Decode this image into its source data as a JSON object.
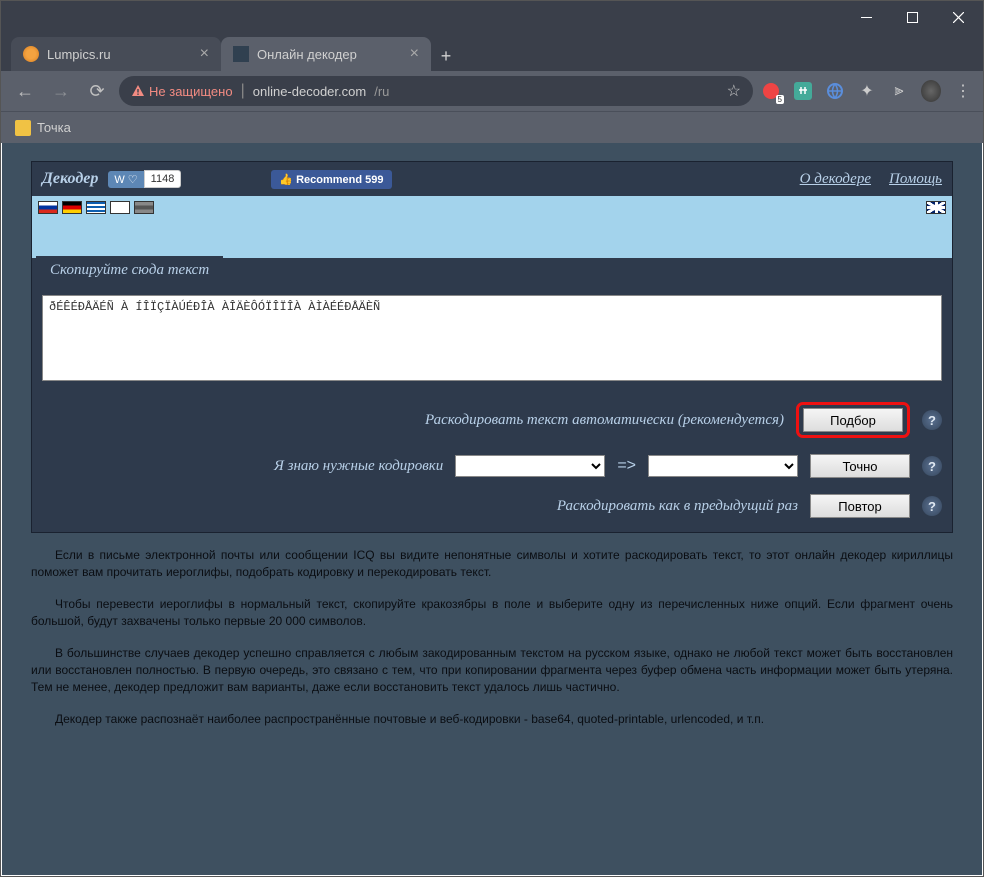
{
  "window": {
    "tabs": [
      {
        "title": "Lumpics.ru"
      },
      {
        "title": "Онлайн декодер"
      }
    ]
  },
  "address": {
    "secure_label": "Не защищено",
    "host": "online-decoder.com",
    "path": "/ru"
  },
  "bookmarks": {
    "item0": "Точка"
  },
  "ext": {
    "badge": "5"
  },
  "decoder": {
    "brand": "Декодер",
    "vk_count": "1148",
    "fb_label": "Recommend 599",
    "link_about": "О декодере",
    "link_help": "Помощь",
    "section_label": "Скопируйте сюда текст",
    "textarea_value": "ðÉÊÉÐÅÄÉÑ À ÍÎÏÇÏÀÚÉÐÎÀ ÀÎÄÈÔÓÏÎÏÎÀ ÀÌÀÉÉÐÅÄÈÑ",
    "row1_label": "Раскодировать текст автоматически (рекомендуется)",
    "row2_label": "Я знаю нужные кодировки",
    "row3_label": "Раскодировать как в предыдущий раз",
    "btn_podbor": "Подбор",
    "btn_tochno": "Точно",
    "btn_povtor": "Повтор"
  },
  "paragraphs": {
    "p1": "Если в письме электронной почты или сообщении ICQ вы видите непонятные символы и хотите раскодировать текст, то этот онлайн декодер кириллицы поможет вам прочитать иероглифы, подобрать кодировку и перекодировать текст.",
    "p2": "Чтобы перевести иероглифы в нормальный текст, скопируйте кракозябры в поле и выберите одну из перечисленных ниже опций. Если фрагмент очень большой, будут захвачены только первые 20 000 символов.",
    "p3": "В большинстве случаев декодер успешно справляется с любым закодированным текстом на русском языке, однако не любой текст может быть восстановлен или восстановлен полностью. В первую очередь, это связано с тем, что при копировании фрагмента через буфер обмена часть информации может быть утеряна. Тем не менее, декодер предложит вам варианты, даже если восстановить текст удалось лишь частично.",
    "p4": "Декодер также распознаёт наиболее распространённые почтовые и веб-кодировки - base64, quoted-printable, urlencoded, и т.п."
  }
}
